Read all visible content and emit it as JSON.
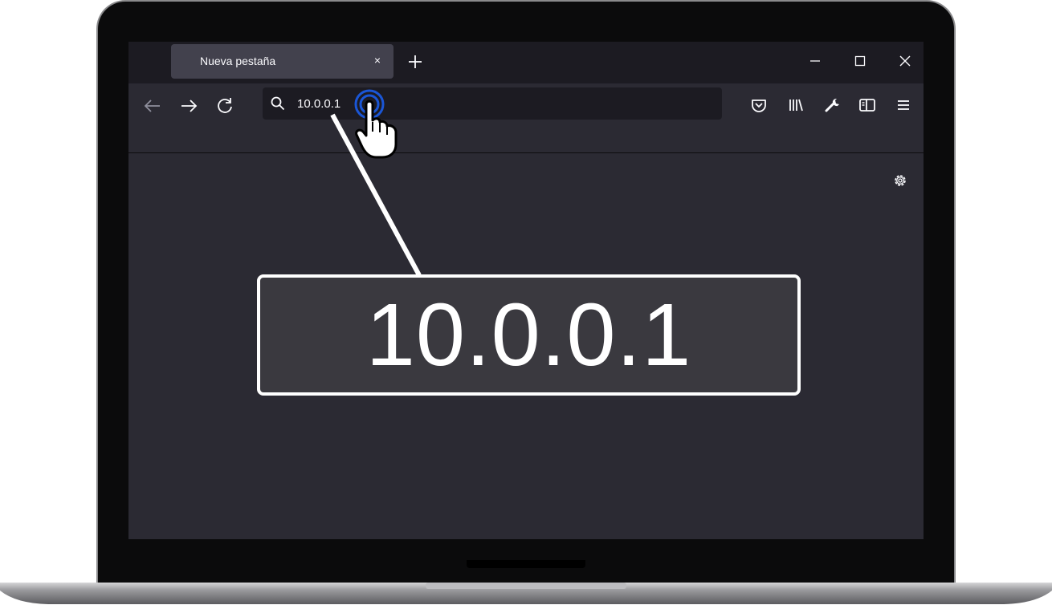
{
  "tab": {
    "title": "Nueva pestaña",
    "close_glyph": "×",
    "new_tab_icon": "plus-icon"
  },
  "window_controls": [
    "minimize-icon",
    "maximize-icon",
    "close-icon"
  ],
  "nav": [
    "back-arrow-icon",
    "forward-arrow-icon",
    "reload-icon"
  ],
  "url": {
    "value": "10.0.0.1",
    "icon": "search-icon"
  },
  "toolbar_icons": [
    "pocket-icon",
    "library-icon",
    "wrench-icon",
    "sidebar-icon",
    "menu-icon"
  ],
  "page": {
    "settings_icon": "gear-icon"
  },
  "callout": {
    "text": "10.0.0.1"
  },
  "colors": {
    "tab_bar": "#1c1b22",
    "tab_active": "#42414d",
    "toolbar": "#2b2a33",
    "urlbar": "#1c1b22",
    "callout_bg": "#3a393f",
    "click_ring": "#1a56d6"
  }
}
